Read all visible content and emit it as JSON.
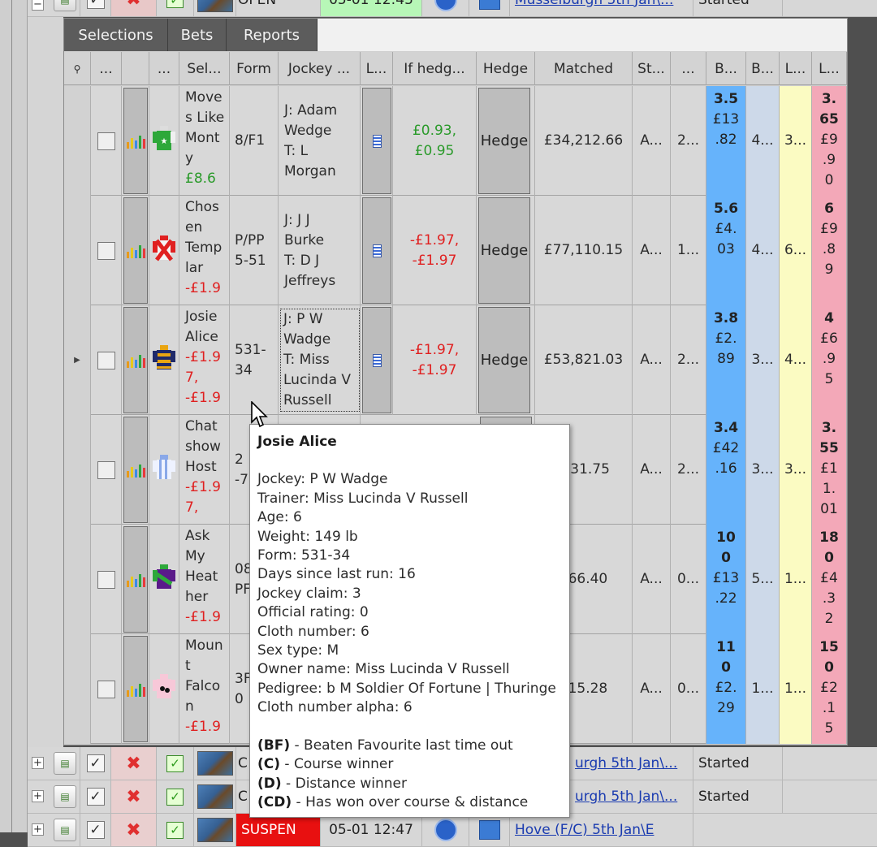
{
  "top_row": {
    "status": "OPEN",
    "time": "05-01 12:45",
    "race_link": "Musselburgh 5th Jan\\...",
    "race_status": "Started"
  },
  "tabs": [
    "Selections",
    "Bets",
    "Reports"
  ],
  "columns": [
    {
      "key": "search",
      "label": ""
    },
    {
      "key": "c1",
      "label": "..."
    },
    {
      "key": "c2",
      "label": ""
    },
    {
      "key": "c3",
      "label": "..."
    },
    {
      "key": "sel",
      "label": "Sel..."
    },
    {
      "key": "form",
      "label": "Form"
    },
    {
      "key": "jockey",
      "label": "Jockey ..."
    },
    {
      "key": "l",
      "label": "L..."
    },
    {
      "key": "ifhedge",
      "label": "If hedg..."
    },
    {
      "key": "hedge",
      "label": "Hedge"
    },
    {
      "key": "matched",
      "label": "Matched"
    },
    {
      "key": "st",
      "label": "St..."
    },
    {
      "key": "c12",
      "label": "..."
    },
    {
      "key": "b1",
      "label": "B..."
    },
    {
      "key": "b2",
      "label": "B..."
    },
    {
      "key": "l1",
      "label": "L..."
    },
    {
      "key": "l2",
      "label": "L..."
    }
  ],
  "rows": [
    {
      "name": [
        "Move",
        "s Like",
        "Mont",
        "y"
      ],
      "pl": "£8.6",
      "pl_color": "green",
      "form": "8/F1",
      "jockey": [
        "J: Adam",
        "Wedge",
        "T: L",
        "Morgan"
      ],
      "ifhedge": "£0.93,",
      "ifhedge2": "£0.95",
      "ih_color": "green",
      "hedge": "Hedge",
      "matched": "£34,212.66",
      "st": "A...",
      "c12": "2...",
      "back1": [
        "3.5",
        "£13",
        ".82"
      ],
      "back2": "4...",
      "lay1": "3...",
      "lay2": [
        "3.",
        "65",
        "£9",
        ".9",
        "0"
      ],
      "silk": "green"
    },
    {
      "name": [
        "Chos",
        "en",
        "Temp",
        "lar"
      ],
      "pl": "-£1.9",
      "pl_color": "red",
      "form": "P/PP\n5-51",
      "jockey": [
        "J: J J",
        "Burke",
        "T: D J",
        "Jeffreys"
      ],
      "ifhedge": "-£1.97,",
      "ifhedge2": "-£1.97",
      "ih_color": "red",
      "hedge": "Hedge",
      "matched": "£77,110.15",
      "st": "A...",
      "c12": "1...",
      "back1": [
        "5.6",
        "£4.",
        "03"
      ],
      "back2": "4...",
      "lay1": "6...",
      "lay2": [
        "6",
        "£9",
        ".8",
        "9"
      ],
      "silk": "cross"
    },
    {
      "name": [
        "Josie",
        "Alice",
        "-£1.9",
        "7,"
      ],
      "pl": "-£1.9",
      "pl_color": "red",
      "form": "531-\n34",
      "jockey": [
        "J: P W",
        "Wadge",
        "T: Miss",
        "Lucinda V",
        "Russell"
      ],
      "ifhedge": "-£1.97,",
      "ifhedge2": "-£1.97",
      "ih_color": "red",
      "hedge": "Hedge",
      "matched": "£53,821.03",
      "st": "A...",
      "c12": "2...",
      "back1": [
        "3.8",
        "£2.",
        "89"
      ],
      "back2": "3...",
      "lay1": "4...",
      "lay2": [
        "4",
        "£6",
        ".9",
        "5"
      ],
      "silk": "hoops"
    },
    {
      "name": [
        "Chat",
        "show",
        "Host",
        "-£1.9",
        "7,"
      ],
      "pl": "",
      "pl_color": "red",
      "form": "2\n-7",
      "jockey": [],
      "ifhedge": "",
      "ifhedge2": "",
      "ih_color": "red",
      "hedge": "",
      "matched": ".731.75",
      "st": "A...",
      "c12": "2...",
      "back1": [
        "3.4",
        "£42",
        ".16"
      ],
      "back2": "3...",
      "lay1": "3...",
      "lay2": [
        "3.",
        "55",
        "£1",
        "1.",
        "01"
      ],
      "silk": "stripes"
    },
    {
      "name": [
        "Ask",
        "My",
        "Heat",
        "her"
      ],
      "pl": "-£1.9",
      "pl_color": "red",
      "form": "08\nPF",
      "jockey": [],
      "ifhedge": "",
      "ifhedge2": "",
      "ih_color": "red",
      "hedge": "",
      "matched": "166.40",
      "st": "A...",
      "c12": "0...",
      "back1": [
        "10",
        "0",
        "£13",
        ".22"
      ],
      "back2": "5...",
      "lay1": "1...",
      "lay2": [
        "18",
        "0",
        "£4",
        ".3",
        "2"
      ],
      "silk": "purple"
    },
    {
      "name": [
        "Moun",
        "t",
        "Falco",
        "n"
      ],
      "pl": "-£1.9",
      "pl_color": "red",
      "form": "3F\n0",
      "jockey": [],
      "ifhedge": "",
      "ifhedge2": "",
      "ih_color": "red",
      "hedge": "",
      "matched": "415.28",
      "st": "A...",
      "c12": "0...",
      "back1": [
        "11",
        "0",
        "£2.",
        "29"
      ],
      "back2": "1...",
      "lay1": "1...",
      "lay2": [
        "15",
        "0",
        "£2",
        ".1",
        "5"
      ],
      "silk": "pink"
    }
  ],
  "tooltip": {
    "title": "Josie Alice",
    "lines": [
      "Jockey: P W Wadge",
      "Trainer: Miss Lucinda V Russell",
      "Age: 6",
      "Weight: 149 lb",
      "Form: 531-34",
      "Days since last run: 16",
      "Jockey claim: 3",
      "Official rating: 0",
      "Cloth number: 6",
      "Sex type: M",
      "Owner name: Miss Lucinda V Russell",
      "Pedigree: b M Soldier Of Fortune | Thuringe",
      "Cloth number alpha: 6"
    ],
    "legend": [
      {
        "code": "(BF)",
        "text": " - Beaten Favourite last time out"
      },
      {
        "code": "(C)",
        "text": " - Course winner"
      },
      {
        "code": "(D)",
        "text": " - Distance winner"
      },
      {
        "code": "(CD)",
        "text": " - Has won over course & distance"
      }
    ]
  },
  "bottom_rows": [
    {
      "letter": "C",
      "link": "urgh 5th Jan\\...",
      "status": "Started"
    },
    {
      "letter": "C",
      "link": "urgh 5th Jan\\...",
      "status": "Started"
    },
    {
      "status": "SUSPEN",
      "time": "05-01 12:47",
      "link": "Hove (F/C) 5th Jan\\E"
    }
  ],
  "colors": {
    "back1": "#66b3fb",
    "back2": "#cdd9e9",
    "lay1": "#fbfbc2",
    "lay2": "#f3a8b8",
    "suspended": "#e81010"
  }
}
